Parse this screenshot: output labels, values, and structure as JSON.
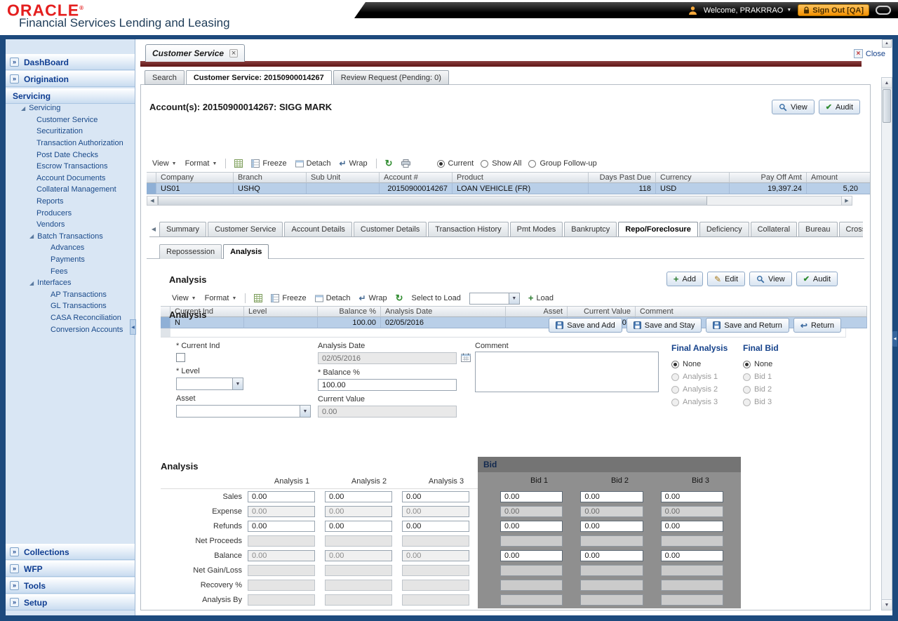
{
  "colors": {
    "oracle_red": "#e41e1e",
    "title_navy": "#1d3b57",
    "frame_blue": "#1d4a7d",
    "sidebar_link_blue": "#0f3d91",
    "selected_row_blue": "#b9cfe8",
    "signout_orange": "#f39000",
    "tabstrip_maroon": "#6b1d1d",
    "bid_panel_gray": "#8f8f8f"
  },
  "glyphs": {
    "chevrons": "»",
    "tree_open": "◢",
    "caret_down": "▼",
    "up": "▲",
    "down": "▼",
    "left": "◀",
    "right": "▶",
    "wrap": "↵",
    "close_x": "×",
    "tab_x": "×",
    "check": "✔",
    "pencil": "✎",
    "plus": "+",
    "refresh": "↻",
    "return_arrow": "↩"
  },
  "header": {
    "logo": "ORACLE",
    "registered": "®",
    "app_title": "Financial Services Lending and Leasing",
    "welcome": "Welcome, PRAKRRAO",
    "sign_out": "Sign Out [QA]"
  },
  "sidebar": {
    "top_sections": [
      {
        "label": "DashBoard"
      },
      {
        "label": "Origination"
      }
    ],
    "servicing_header": "Servicing",
    "tree": {
      "root": "Servicing",
      "items": [
        {
          "label": "Customer Service"
        },
        {
          "label": "Securitization"
        },
        {
          "label": "Transaction Authorization"
        },
        {
          "label": "Post Date Checks"
        },
        {
          "label": "Escrow Transactions"
        },
        {
          "label": "Account Documents"
        },
        {
          "label": "Collateral Management"
        },
        {
          "label": "Reports"
        },
        {
          "label": "Producers"
        },
        {
          "label": "Vendors"
        }
      ],
      "batch": {
        "label": "Batch Transactions",
        "items": [
          {
            "label": "Advances"
          },
          {
            "label": "Payments"
          },
          {
            "label": "Fees"
          }
        ]
      },
      "interfaces": {
        "label": "Interfaces",
        "items": [
          {
            "label": "AP Transactions"
          },
          {
            "label": "GL Transactions"
          },
          {
            "label": "CASA Reconciliation"
          },
          {
            "label": "Conversion Accounts"
          }
        ]
      }
    },
    "bottom_sections": [
      {
        "label": "Collections"
      },
      {
        "label": "WFP"
      },
      {
        "label": "Tools"
      },
      {
        "label": "Setup"
      }
    ]
  },
  "window": {
    "tab": "Customer Service",
    "close": "Close"
  },
  "page_tabs": [
    {
      "label": "Search"
    },
    {
      "label": "Customer Service: 20150900014267",
      "state": "active"
    },
    {
      "label": "Review Request (Pending: 0)"
    }
  ],
  "toolbar": {
    "view": "View",
    "format": "Format",
    "freeze": "Freeze",
    "detach": "Detach",
    "wrap": "Wrap",
    "select_to_load": "Select to Load",
    "load": "Load"
  },
  "account": {
    "title": "Account(s): 20150900014267: SIGG MARK",
    "view_btn": "View",
    "audit_btn": "Audit",
    "radios": [
      {
        "label": "Current",
        "state": "checked"
      },
      {
        "label": "Show All"
      },
      {
        "label": "Group Follow-up"
      }
    ],
    "grid": {
      "columns": [
        "Company",
        "Branch",
        "Sub Unit",
        "Account #",
        "Product",
        "Days Past Due",
        "Currency",
        "Pay Off Amt",
        "Amount"
      ],
      "row": {
        "company": "US01",
        "branch": "USHQ",
        "sub_unit": "",
        "account": "20150900014267",
        "product": "LOAN VEHICLE (FR)",
        "days_past_due": "118",
        "currency": "USD",
        "pay_off_amt": "19,397.24",
        "amount": "5,20"
      }
    }
  },
  "repo_tabs": [
    {
      "label": "Summary"
    },
    {
      "label": "Customer Service"
    },
    {
      "label": "Account Details"
    },
    {
      "label": "Customer Details"
    },
    {
      "label": "Transaction History"
    },
    {
      "label": "Pmt Modes"
    },
    {
      "label": "Bankruptcy"
    },
    {
      "label": "Repo/Foreclosure",
      "state": "active"
    },
    {
      "label": "Deficiency"
    },
    {
      "label": "Collateral"
    },
    {
      "label": "Bureau"
    },
    {
      "label": "Cross/Up"
    }
  ],
  "sub_tabs": [
    {
      "label": "Repossession"
    },
    {
      "label": "Analysis",
      "state": "active"
    }
  ],
  "analysis_grid": {
    "title": "Analysis",
    "add_btn": "Add",
    "edit_btn": "Edit",
    "view_btn": "View",
    "audit_btn": "Audit",
    "columns": [
      "Current Ind",
      "Level",
      "Balance %",
      "Analysis Date",
      "Asset",
      "Current Value",
      "Comment"
    ],
    "row": {
      "current_ind": "N",
      "level": "",
      "balance_pct": "100.00",
      "analysis_date": "02/05/2016",
      "asset": "",
      "current_value": "0.00",
      "comment": ""
    }
  },
  "analysis_form": {
    "title": "Analysis",
    "save_add": "Save and Add",
    "save_stay": "Save and Stay",
    "save_return": "Save and Return",
    "return_btn": "Return",
    "labels": {
      "current_ind": "* Current Ind",
      "level": "* Level",
      "asset": "Asset",
      "analysis_date": "Analysis Date",
      "balance_pct": "* Balance %",
      "current_value": "Current Value",
      "comment": "Comment"
    },
    "values": {
      "level": "",
      "asset": "",
      "analysis_date": "02/05/2016",
      "balance_pct": "100.00",
      "current_value": "0.00",
      "comment": ""
    },
    "final_analysis": {
      "title": "Final Analysis",
      "options": [
        {
          "label": "None",
          "state": "checked"
        },
        {
          "label": "Analysis 1",
          "state": "disabled"
        },
        {
          "label": "Analysis 2",
          "state": "disabled"
        },
        {
          "label": "Analysis 3",
          "state": "disabled"
        }
      ]
    },
    "final_bid": {
      "title": "Final Bid",
      "options": [
        {
          "label": "None",
          "state": "checked"
        },
        {
          "label": "Bid 1",
          "state": "disabled"
        },
        {
          "label": "Bid 2",
          "state": "disabled"
        },
        {
          "label": "Bid 3",
          "state": "disabled"
        }
      ]
    }
  },
  "analysis_matrix": {
    "title": "Analysis",
    "columns": [
      "Analysis 1",
      "Analysis 2",
      "Analysis 3"
    ],
    "rows": [
      {
        "label": "Sales",
        "v1": "0.00",
        "v2": "0.00",
        "v3": "0.00"
      },
      {
        "label": "Expense",
        "v1": "0.00",
        "v2": "0.00",
        "v3": "0.00",
        "state": "dim"
      },
      {
        "label": "Refunds",
        "v1": "0.00",
        "v2": "0.00",
        "v3": "0.00"
      },
      {
        "label": "Net Proceeds",
        "v1": "",
        "v2": "",
        "v3": "",
        "state": "ro"
      },
      {
        "label": "Balance",
        "v1": "0.00",
        "v2": "0.00",
        "v3": "0.00",
        "state": "dim"
      },
      {
        "label": "Net Gain/Loss",
        "v1": "",
        "v2": "",
        "v3": "",
        "state": "ro"
      },
      {
        "label": "Recovery %",
        "v1": "",
        "v2": "",
        "v3": "",
        "state": "ro"
      },
      {
        "label": "Analysis By",
        "v1": "",
        "v2": "",
        "v3": "",
        "state": "ro"
      }
    ]
  },
  "bid_matrix": {
    "title": "Bid",
    "columns": [
      "Bid 1",
      "Bid 2",
      "Bid 3"
    ],
    "rows": [
      {
        "v1": "0.00",
        "v2": "0.00",
        "v3": "0.00"
      },
      {
        "v1": "0.00",
        "v2": "0.00",
        "v3": "0.00",
        "state": "dim"
      },
      {
        "v1": "0.00",
        "v2": "0.00",
        "v3": "0.00"
      },
      {
        "v1": "",
        "v2": "",
        "v3": "",
        "state": "ro"
      },
      {
        "v1": "0.00",
        "v2": "0.00",
        "v3": "0.00"
      },
      {
        "v1": "",
        "v2": "",
        "v3": "",
        "state": "ro"
      },
      {
        "v1": "",
        "v2": "",
        "v3": "",
        "state": "ro"
      },
      {
        "v1": "",
        "v2": "",
        "v3": "",
        "state": "ro"
      }
    ]
  }
}
